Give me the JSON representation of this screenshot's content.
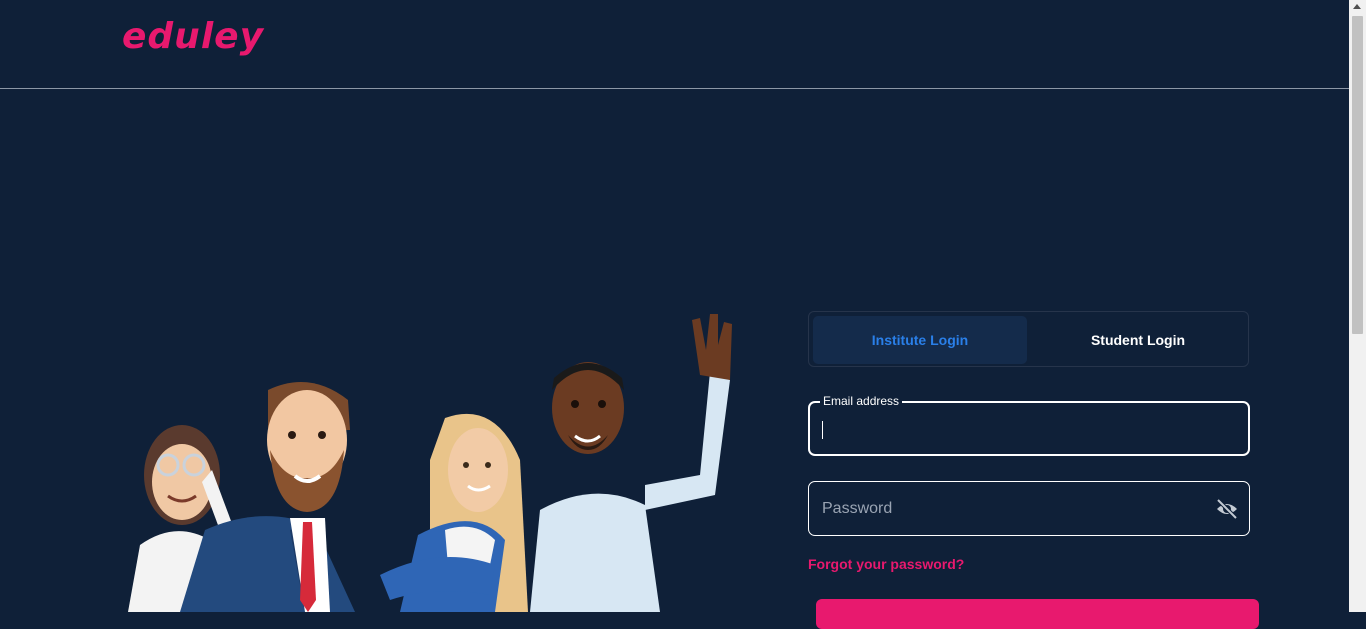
{
  "brand": {
    "logo_text": "eduley",
    "accent_color": "#e8196e"
  },
  "login": {
    "tabs": [
      {
        "label": "Institute Login",
        "active": true
      },
      {
        "label": "Student Login",
        "active": false
      }
    ],
    "email": {
      "label": "Email address",
      "value": ""
    },
    "password": {
      "placeholder": "Password",
      "toggle_icon": "eye-off-icon"
    },
    "forgot_link": "Forgot your password?"
  },
  "colors": {
    "background": "#0f2038",
    "active_tab_text": "#2a7fe8",
    "active_tab_bg": "#142b4b"
  }
}
